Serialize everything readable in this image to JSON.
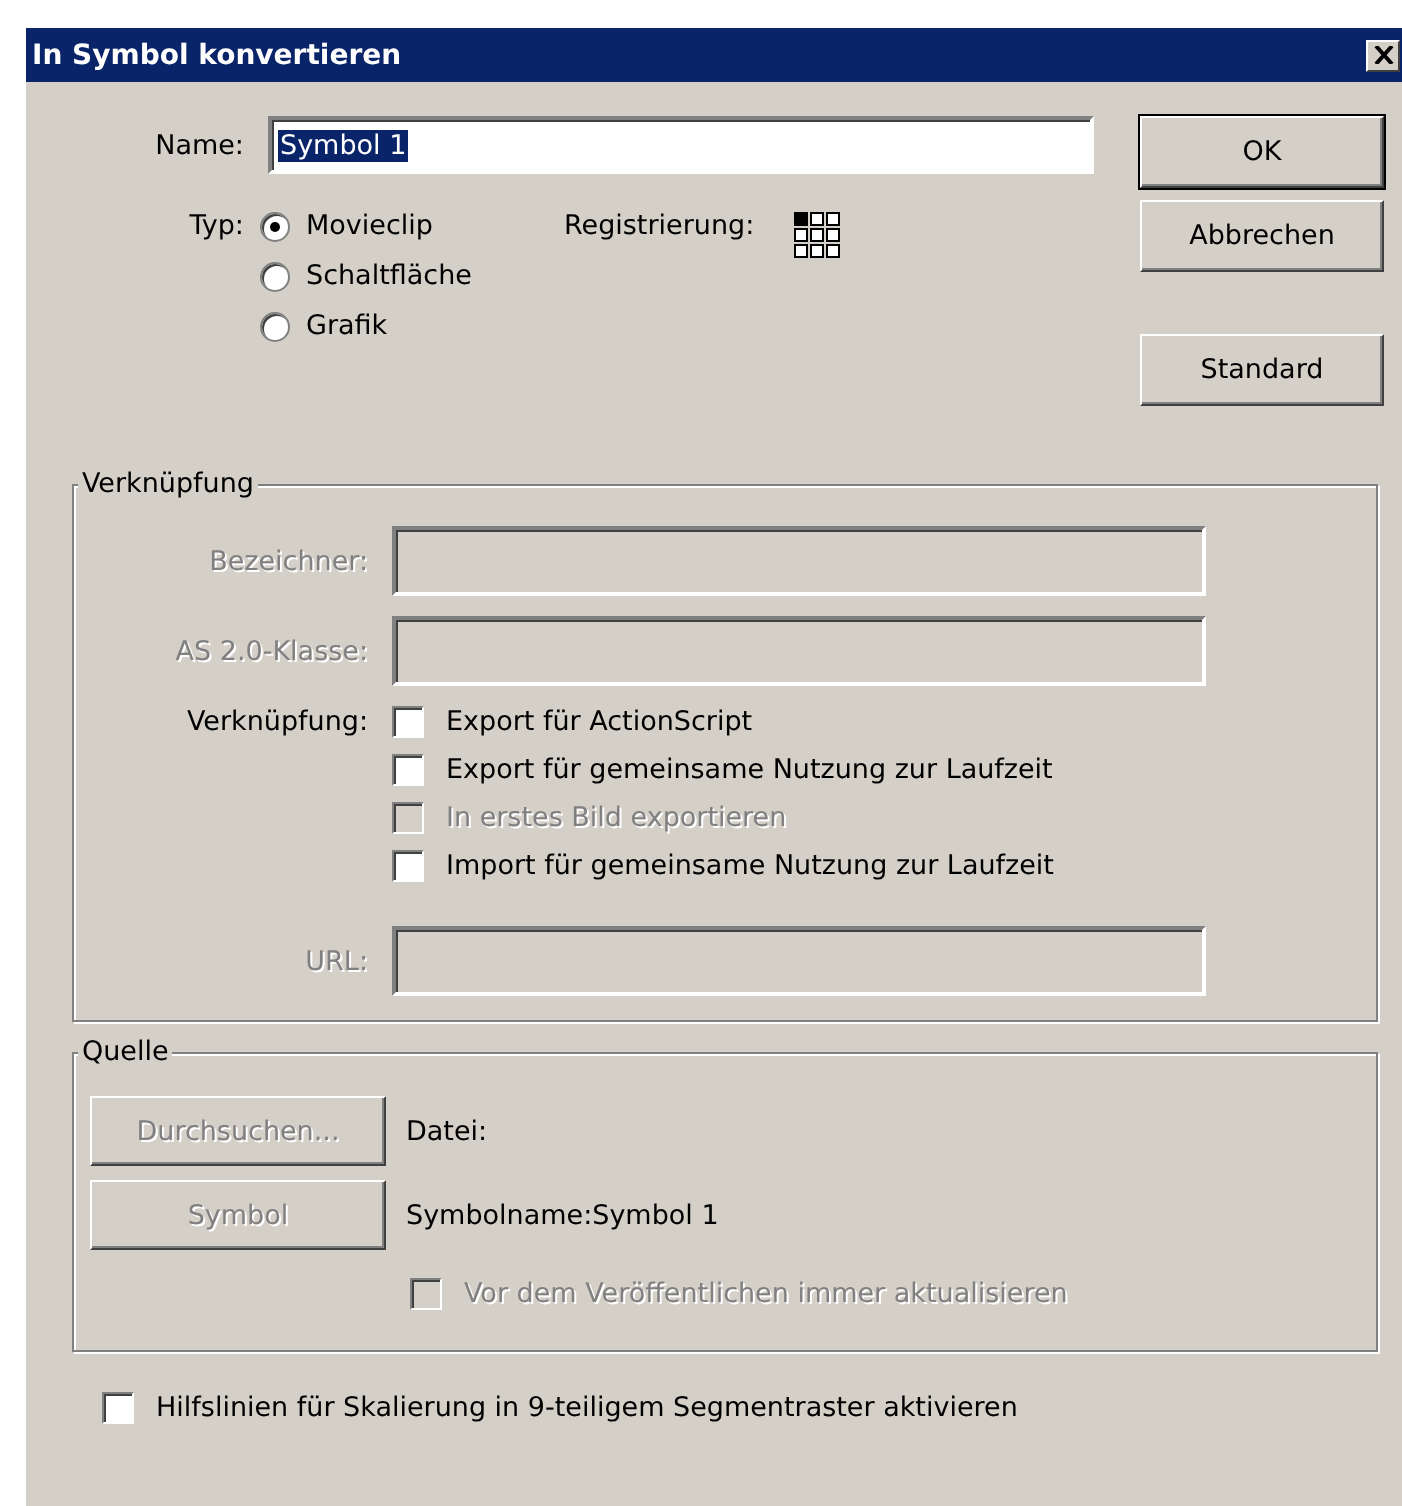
{
  "window": {
    "title": "In Symbol konvertieren"
  },
  "name_field": {
    "label": "Name:",
    "value": "Symbol 1",
    "value_selected": true
  },
  "type": {
    "label": "Typ:",
    "options": [
      {
        "label": "Movieclip",
        "selected": true
      },
      {
        "label": "Schaltfläche",
        "selected": false
      },
      {
        "label": "Grafik",
        "selected": false
      }
    ]
  },
  "registration": {
    "label": "Registrierung:",
    "points": [
      {
        "selected": true
      },
      {
        "selected": false
      },
      {
        "selected": false
      },
      {
        "selected": false
      },
      {
        "selected": false
      },
      {
        "selected": false
      },
      {
        "selected": false
      },
      {
        "selected": false
      },
      {
        "selected": false
      }
    ]
  },
  "buttons": [
    {
      "label": "OK",
      "default": true
    },
    {
      "label": "Abbrechen",
      "default": false
    },
    {
      "label": "Standard",
      "default": false
    }
  ],
  "linkage": {
    "title": "Verknüpfung",
    "fields": [
      {
        "label": "Bezeichner:",
        "disabled": true
      },
      {
        "label": "AS 2.0-Klasse:",
        "disabled": true
      }
    ],
    "checkbox_label": "Verknüpfung:",
    "options": [
      {
        "label": "Export für ActionScript",
        "checked": false,
        "disabled": false
      },
      {
        "label": "Export für gemeinsame Nutzung zur Laufzeit",
        "checked": false,
        "disabled": false
      },
      {
        "label": "In erstes Bild exportieren",
        "checked": false,
        "disabled": true
      },
      {
        "label": "Import für gemeinsame Nutzung zur Laufzeit",
        "checked": false,
        "disabled": false
      }
    ],
    "url": {
      "label": "URL:",
      "disabled": true
    }
  },
  "source": {
    "title": "Quelle",
    "rows": [
      {
        "button": "Durchsuchen...",
        "disabled": true,
        "text": "Datei:"
      },
      {
        "button": "Symbol",
        "disabled": true,
        "text": "Symbolname:Symbol 1"
      }
    ],
    "update": {
      "label": "Vor dem Veröffentlichen immer aktualisieren",
      "checked": false,
      "disabled": true
    }
  },
  "guides": {
    "label": "Hilfslinien für Skalierung in 9-teiligem Segmentraster aktivieren",
    "checked": false
  }
}
